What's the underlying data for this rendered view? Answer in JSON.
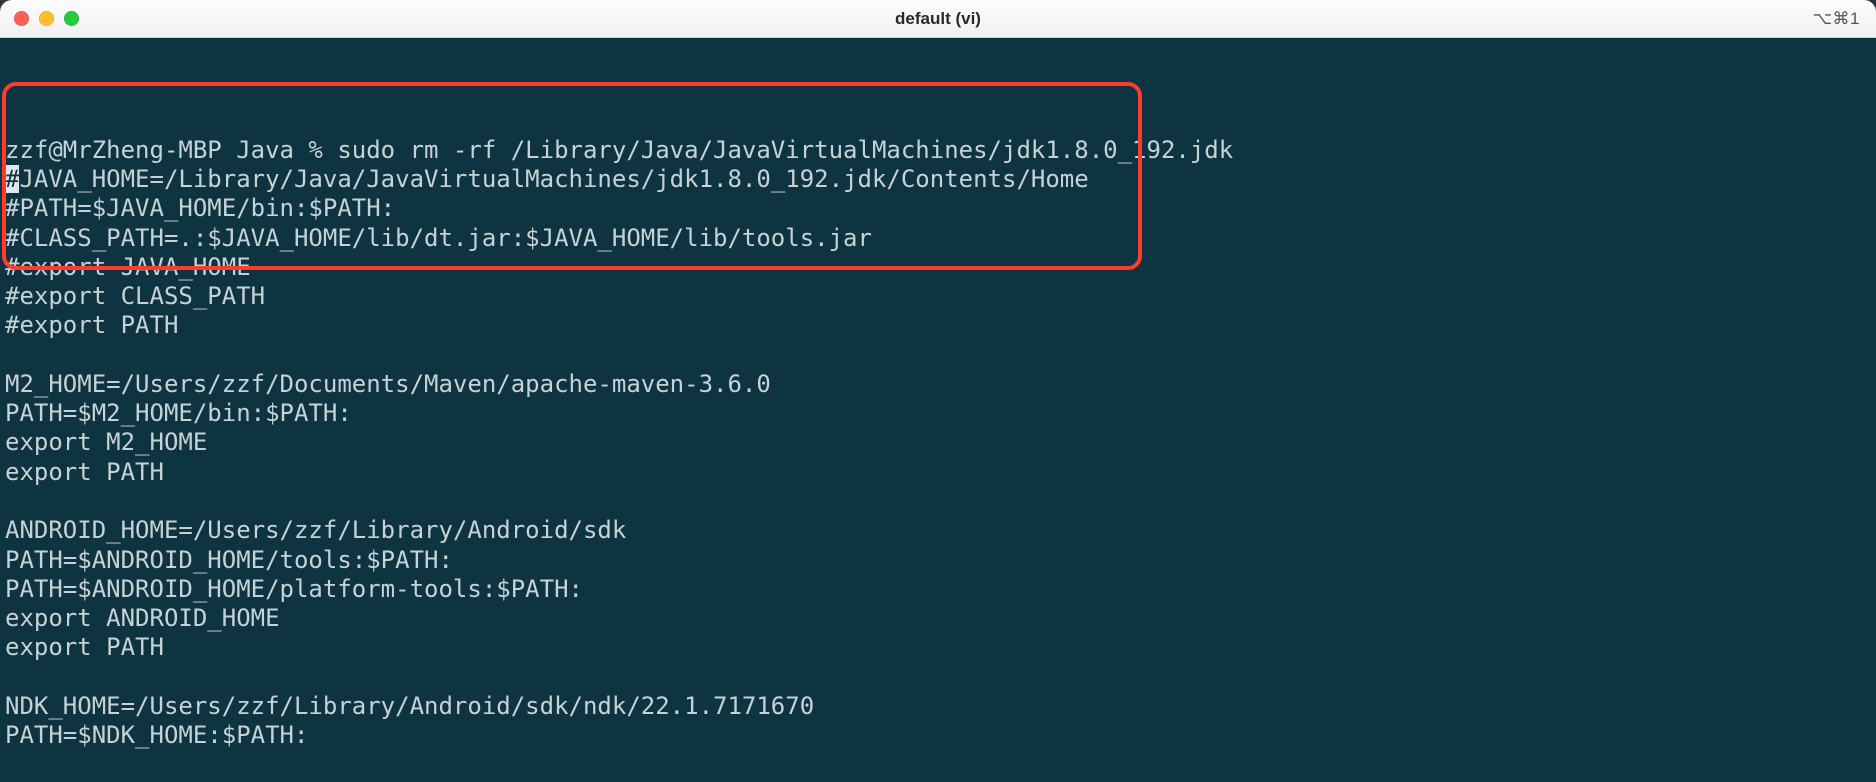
{
  "window": {
    "title": "default (vi)",
    "shortcut_hint": "⌥⌘1"
  },
  "terminal": {
    "lines": [
      "zzf@MrZheng-MBP Java % sudo rm -rf /Library/Java/JavaVirtualMachines/jdk1.8.0_192.jdk",
      "#JAVA_HOME=/Library/Java/JavaVirtualMachines/jdk1.8.0_192.jdk/Contents/Home",
      "#PATH=$JAVA_HOME/bin:$PATH:",
      "#CLASS_PATH=.:$JAVA_HOME/lib/dt.jar:$JAVA_HOME/lib/tools.jar",
      "#export JAVA_HOME",
      "#export CLASS_PATH",
      "#export PATH",
      "",
      "M2_HOME=/Users/zzf/Documents/Maven/apache-maven-3.6.0",
      "PATH=$M2_HOME/bin:$PATH:",
      "export M2_HOME",
      "export PATH",
      "",
      "ANDROID_HOME=/Users/zzf/Library/Android/sdk",
      "PATH=$ANDROID_HOME/tools:$PATH:",
      "PATH=$ANDROID_HOME/platform-tools:$PATH:",
      "export ANDROID_HOME",
      "export PATH",
      "",
      "NDK_HOME=/Users/zzf/Library/Android/sdk/ndk/22.1.7171670",
      "PATH=$NDK_HOME:$PATH:"
    ],
    "cursor_line_index": 1,
    "cursor_char_index": 0,
    "cursor_char": "#"
  },
  "annotation": {
    "highlight_start_line": 1,
    "highlight_end_line": 6
  }
}
